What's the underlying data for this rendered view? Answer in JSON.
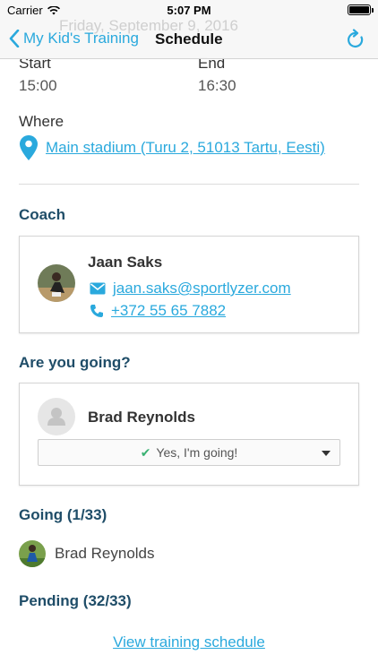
{
  "status_bar": {
    "carrier": "Carrier",
    "time": "5:07 PM"
  },
  "nav": {
    "ghost_date": "Friday, September 9, 2016",
    "back_label": "My Kid's Training",
    "title": "Schedule",
    "accent": "#2aa9dd"
  },
  "details": {
    "start_label": "Start",
    "start_value": "15:00",
    "end_label": "End",
    "end_value": "16:30",
    "where_label": "Where",
    "location": "Main stadium (Turu 2, 51013 Tartu, Eesti)"
  },
  "coach": {
    "section_title": "Coach",
    "name": "Jaan Saks",
    "email": "jaan.saks@sportlyzer.com",
    "phone": "+372 55 65 7882"
  },
  "rsvp": {
    "section_title": "Are you going?",
    "user_name": "Brad Reynolds",
    "selected": "Yes, I'm going!"
  },
  "going": {
    "section_title": "Going (1/33)",
    "attendees": [
      {
        "name": "Brad Reynolds"
      }
    ]
  },
  "pending": {
    "section_title": "Pending (32/33)"
  },
  "footer": {
    "link": "View training schedule"
  },
  "colors": {
    "accent": "#2aa9dd",
    "heading": "#1f4d68",
    "success": "#3bb273"
  }
}
